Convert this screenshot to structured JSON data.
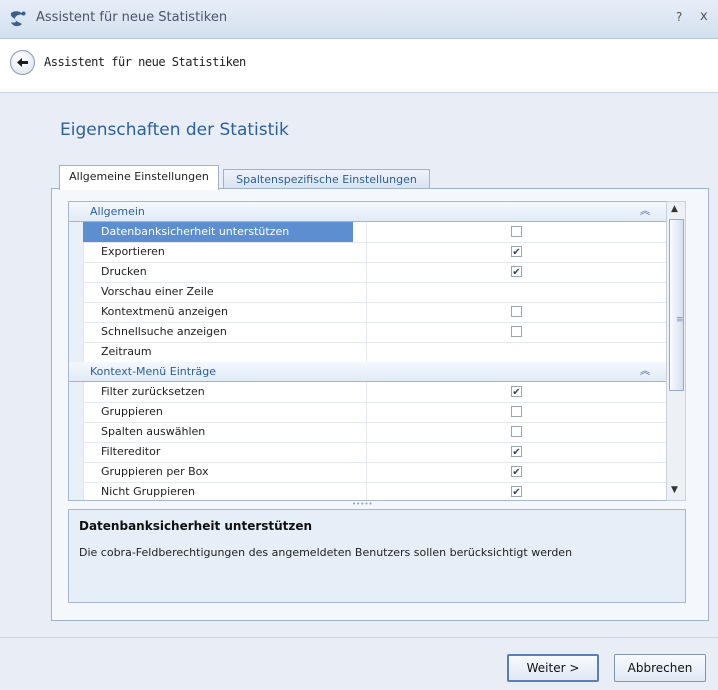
{
  "window": {
    "title": "Assistent für neue Statistiken",
    "help_glyph": "?",
    "close_glyph": "x"
  },
  "nav": {
    "title": "Assistent für neue Statistiken",
    "back_icon": "arrow-left-icon"
  },
  "page": {
    "title": "Eigenschaften der Statistik"
  },
  "tabs": [
    {
      "label": "Allgemeine Einstellungen",
      "active": true
    },
    {
      "label": "Spaltenspezifische Einstellungen",
      "active": false
    }
  ],
  "groups": [
    {
      "label": "Allgemein",
      "rows": [
        {
          "name": "Datenbanksicherheit unterstützen",
          "checkbox": true,
          "checked": false,
          "selected": true
        },
        {
          "name": "Exportieren",
          "checkbox": true,
          "checked": true
        },
        {
          "name": "Drucken",
          "checkbox": true,
          "checked": true
        },
        {
          "name": "Vorschau einer Zeile",
          "checkbox": false
        },
        {
          "name": "Kontextmenü anzeigen",
          "checkbox": true,
          "checked": false
        },
        {
          "name": "Schnellsuche anzeigen",
          "checkbox": true,
          "checked": false
        },
        {
          "name": "Zeitraum",
          "checkbox": false
        }
      ]
    },
    {
      "label": "Kontext-Menü Einträge",
      "rows": [
        {
          "name": "Filter zurücksetzen",
          "checkbox": true,
          "checked": true
        },
        {
          "name": "Gruppieren",
          "checkbox": true,
          "checked": false
        },
        {
          "name": "Spalten auswählen",
          "checkbox": true,
          "checked": false
        },
        {
          "name": "Filtereditor",
          "checkbox": true,
          "checked": true
        },
        {
          "name": "Gruppieren per Box",
          "checkbox": true,
          "checked": true
        },
        {
          "name": "Nicht Gruppieren",
          "checkbox": true,
          "checked": true
        }
      ]
    }
  ],
  "description": {
    "title": "Datenbanksicherheit unterstützen",
    "text": "Die cobra-Feldberechtigungen des angemeldeten Benutzers sollen berücksichtigt werden"
  },
  "buttons": {
    "next": "Weiter >",
    "cancel": "Abbrechen"
  },
  "colors": {
    "accent": "#2b5f9e",
    "selection": "#5d8fd0"
  }
}
